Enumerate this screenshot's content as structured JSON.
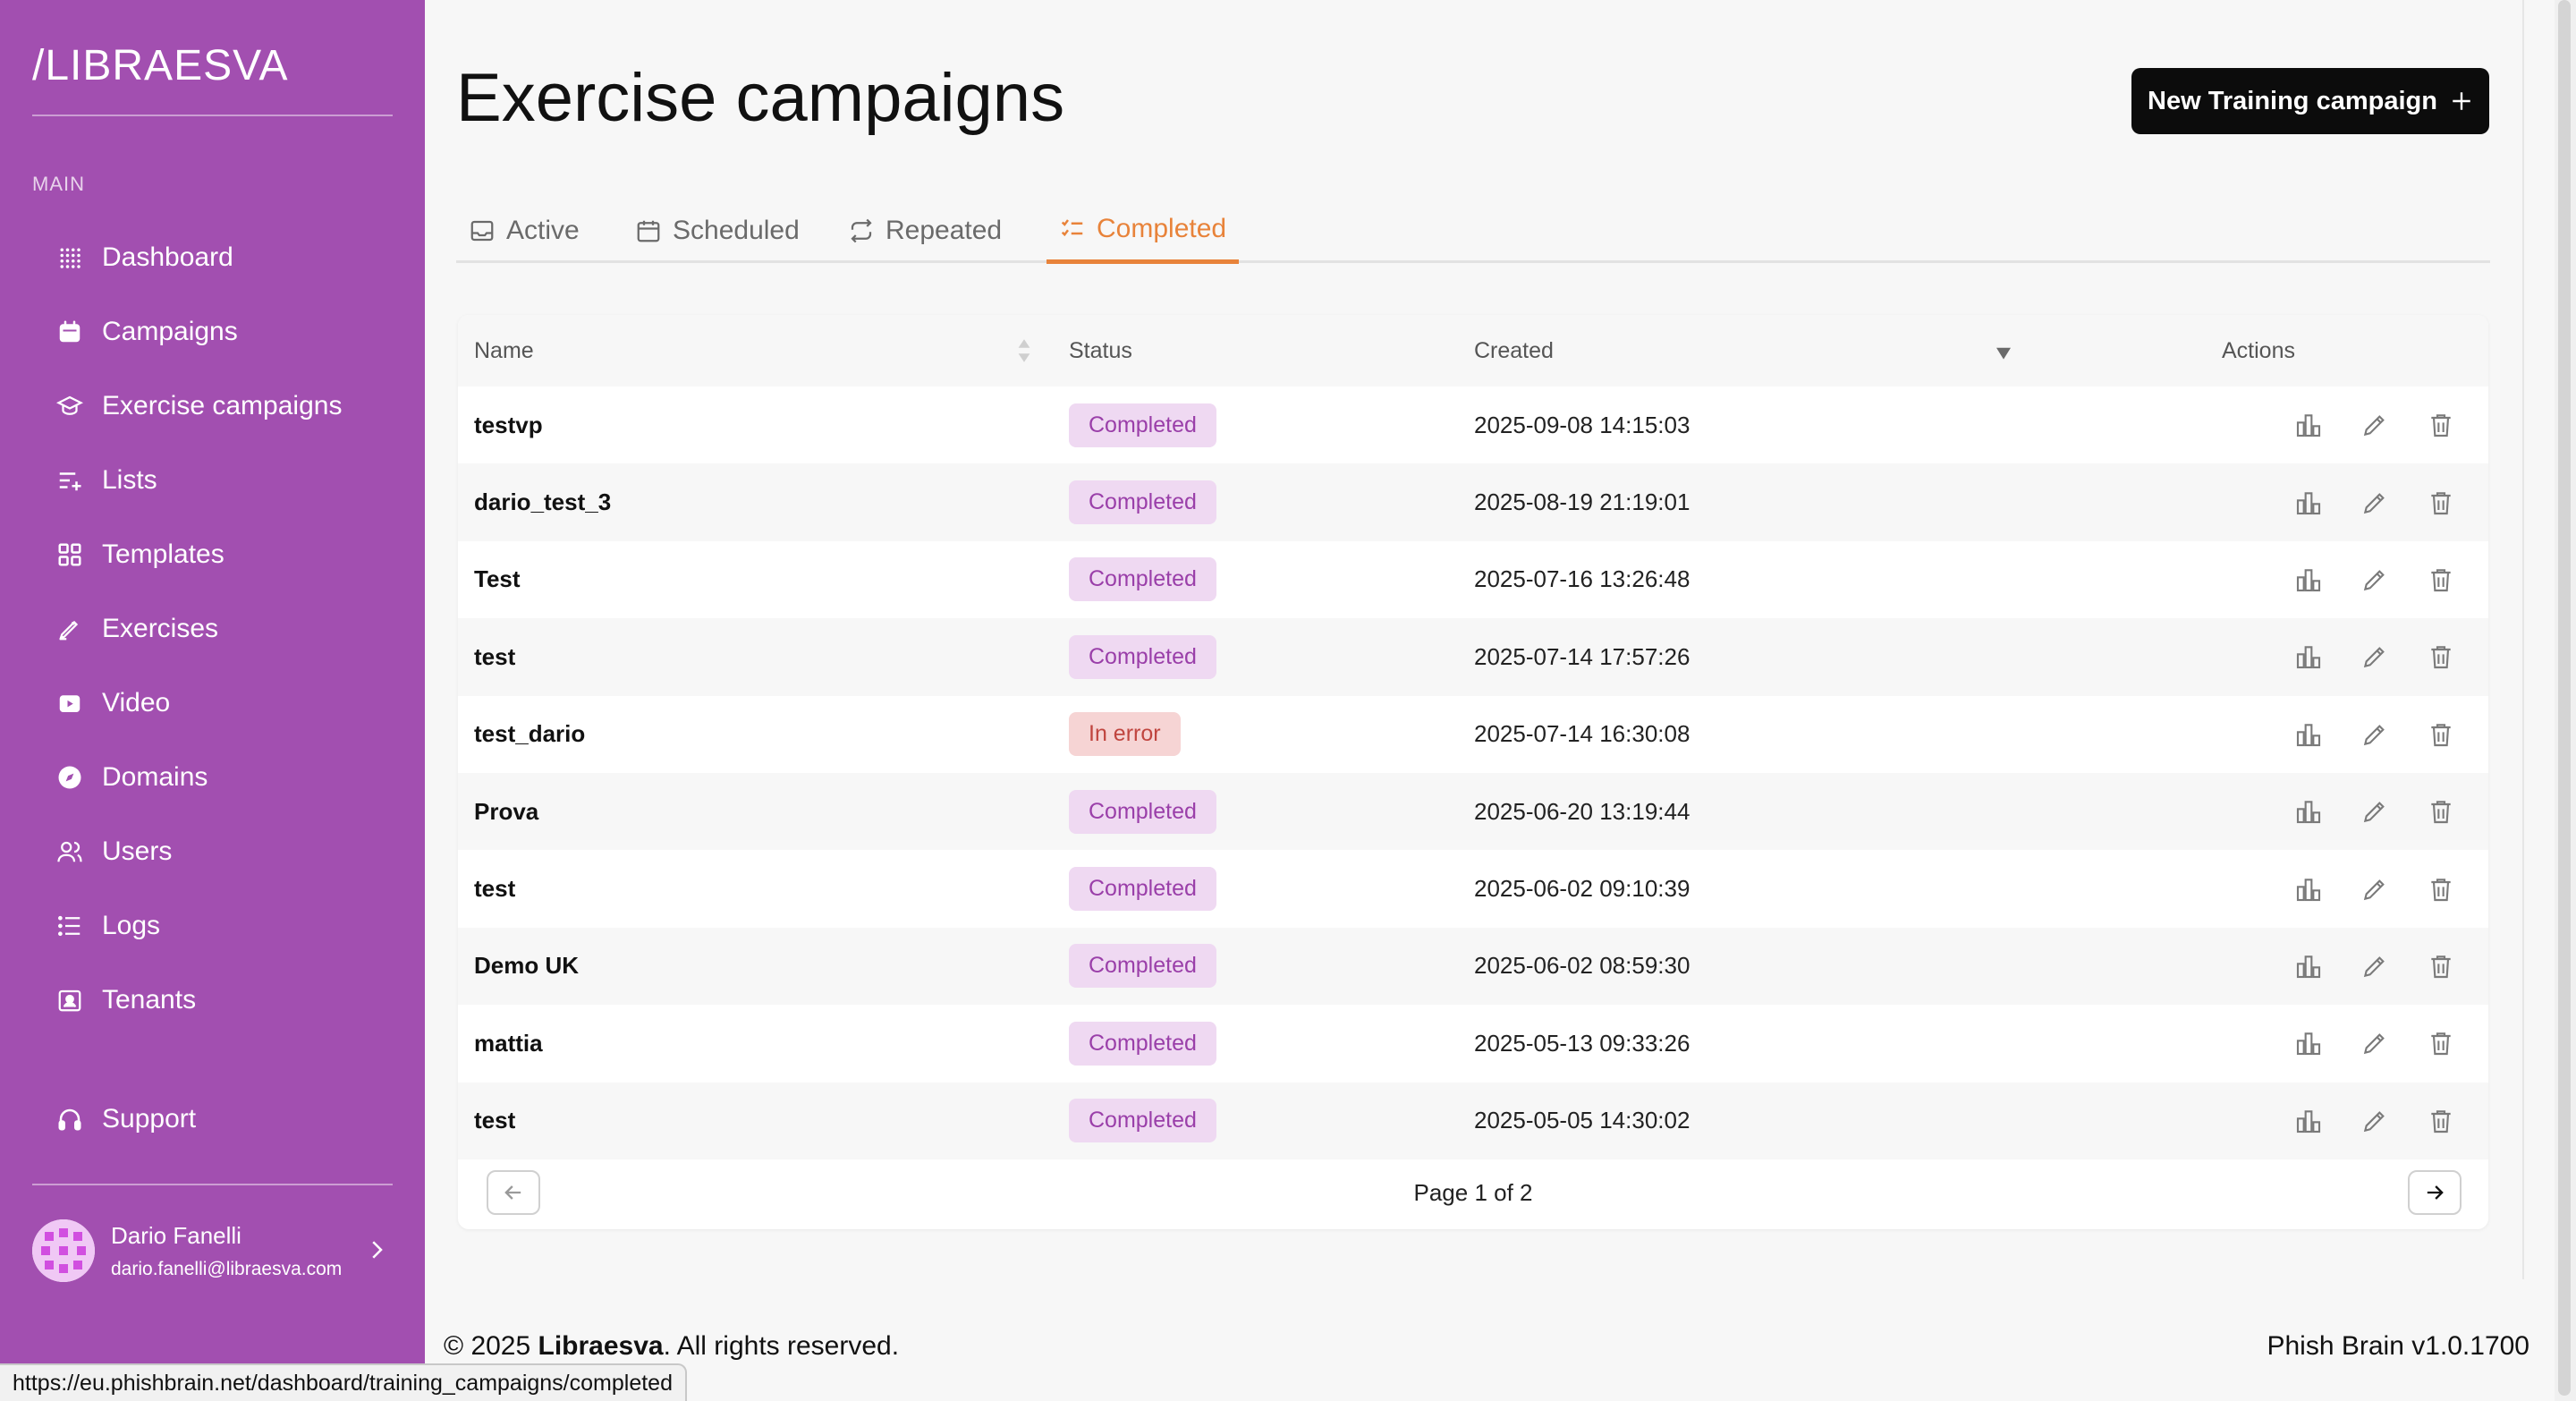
{
  "sidebar": {
    "logo": "/LIBRAESVA",
    "section_label": "MAIN",
    "items": [
      {
        "label": "Dashboard",
        "icon": "dots-grid-icon"
      },
      {
        "label": "Campaigns",
        "icon": "calendar-icon"
      },
      {
        "label": "Exercise campaigns",
        "icon": "graduation-cap-icon"
      },
      {
        "label": "Lists",
        "icon": "list-add-icon"
      },
      {
        "label": "Templates",
        "icon": "templates-grid-icon"
      },
      {
        "label": "Exercises",
        "icon": "pencil-tool-icon"
      },
      {
        "label": "Video",
        "icon": "video-icon"
      },
      {
        "label": "Domains",
        "icon": "compass-icon"
      },
      {
        "label": "Users",
        "icon": "users-icon"
      },
      {
        "label": "Logs",
        "icon": "list-icon"
      },
      {
        "label": "Tenants",
        "icon": "tenants-icon"
      }
    ],
    "support": {
      "label": "Support",
      "icon": "headset-icon"
    },
    "user": {
      "name": "Dario Fanelli",
      "email": "dario.fanelli@libraesva.com"
    }
  },
  "header": {
    "title": "Exercise campaigns",
    "new_button": "New Training campaign"
  },
  "tabs": [
    {
      "label": "Active",
      "icon": "inbox-icon",
      "active": false
    },
    {
      "label": "Scheduled",
      "icon": "calendar-icon",
      "active": false
    },
    {
      "label": "Repeated",
      "icon": "repeat-icon",
      "active": false
    },
    {
      "label": "Completed",
      "icon": "checklist-icon",
      "active": true
    }
  ],
  "table": {
    "columns": {
      "name": "Name",
      "status": "Status",
      "created": "Created",
      "actions": "Actions"
    },
    "rows": [
      {
        "name": "testvp",
        "status": "Completed",
        "created": "2025-09-08 14:15:03"
      },
      {
        "name": "dario_test_3",
        "status": "Completed",
        "created": "2025-08-19 21:19:01"
      },
      {
        "name": "Test",
        "status": "Completed",
        "created": "2025-07-16 13:26:48"
      },
      {
        "name": "test",
        "status": "Completed",
        "created": "2025-07-14 17:57:26"
      },
      {
        "name": "test_dario",
        "status": "In error",
        "created": "2025-07-14 16:30:08"
      },
      {
        "name": "Prova",
        "status": "Completed",
        "created": "2025-06-20 13:19:44"
      },
      {
        "name": "test",
        "status": "Completed",
        "created": "2025-06-02 09:10:39"
      },
      {
        "name": "Demo UK",
        "status": "Completed",
        "created": "2025-06-02 08:59:30"
      },
      {
        "name": "mattia",
        "status": "Completed",
        "created": "2025-05-13 09:33:26"
      },
      {
        "name": "test",
        "status": "Completed",
        "created": "2025-05-05 14:30:02"
      }
    ],
    "pagination": "Page 1 of 2"
  },
  "footer": {
    "copyright_prefix": "© 2025 ",
    "brand": "Libraesva",
    "copyright_suffix": ". All rights reserved.",
    "version": "Phish Brain v1.0.1700"
  },
  "status_url": "https://eu.phishbrain.net/dashboard/training_campaigns/completed",
  "colors": {
    "sidebar": "#a24fb0",
    "accent": "#e8833a",
    "badge_ok": "#efd9f2",
    "badge_err": "#f6d4d4"
  }
}
